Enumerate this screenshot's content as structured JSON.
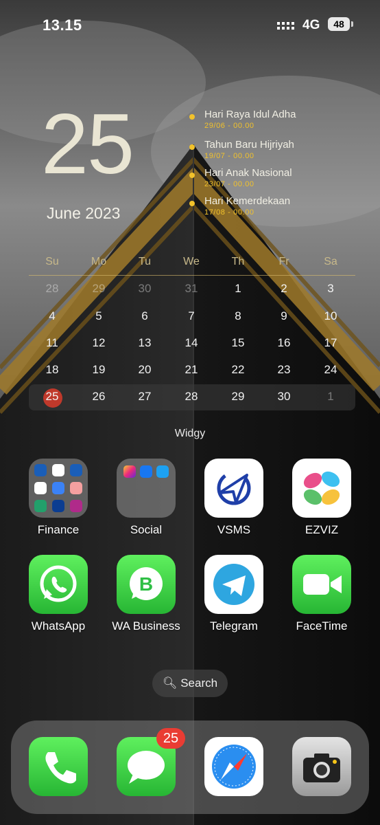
{
  "status_bar": {
    "time": "13.15",
    "network": "4G",
    "battery": "48"
  },
  "widget": {
    "big_day": "25",
    "month_year": "June 2023",
    "events": [
      {
        "name": "Hari Raya Idul Adha",
        "date": "29/06 - 00.00"
      },
      {
        "name": "Tahun Baru Hijriyah",
        "date": "19/07 - 00.00"
      },
      {
        "name": "Hari Anak Nasional",
        "date": "23/07 - 00.00"
      },
      {
        "name": "Hari Kemerdekaan",
        "date": "17/08 - 00.00"
      }
    ],
    "weekdays": [
      "Su",
      "Mo",
      "Tu",
      "We",
      "Th",
      "Fr",
      "Sa"
    ],
    "weeks": [
      [
        "28",
        "29",
        "30",
        "31",
        "1",
        "2",
        "3"
      ],
      [
        "4",
        "5",
        "6",
        "7",
        "8",
        "9",
        "10"
      ],
      [
        "11",
        "12",
        "13",
        "14",
        "15",
        "16",
        "17"
      ],
      [
        "18",
        "19",
        "20",
        "21",
        "22",
        "23",
        "24"
      ],
      [
        "25",
        "26",
        "27",
        "28",
        "29",
        "30",
        "1"
      ]
    ],
    "label": "Widgy"
  },
  "apps": [
    {
      "label": "Finance",
      "icon": "finance-folder"
    },
    {
      "label": "Social",
      "icon": "social-folder"
    },
    {
      "label": "VSMS",
      "icon": "vsms-icon"
    },
    {
      "label": "EZVIZ",
      "icon": "ezviz-icon"
    },
    {
      "label": "WhatsApp",
      "icon": "whatsapp-icon"
    },
    {
      "label": "WA Business",
      "icon": "wa-business-icon"
    },
    {
      "label": "Telegram",
      "icon": "telegram-icon"
    },
    {
      "label": "FaceTime",
      "icon": "facetime-icon"
    }
  ],
  "finance_folder_minis": [
    "BCA mobile",
    "BCA",
    "RTI Business"
  ],
  "search": {
    "label": "Search"
  },
  "dock": {
    "apps": [
      "phone-icon",
      "messages-icon",
      "safari-icon",
      "camera-icon"
    ],
    "messages_badge": "25"
  }
}
